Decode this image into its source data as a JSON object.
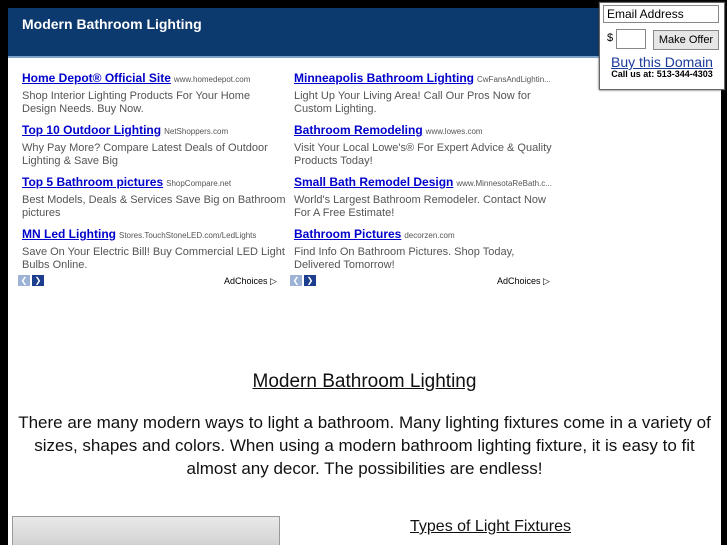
{
  "header": {
    "title": "Modern Bathroom Lighting"
  },
  "ads_left": [
    {
      "title": "Home Depot® Official Site",
      "url": "www.homedepot.com",
      "desc": "Shop Interior Lighting Products For Your Home Design Needs. Buy Now."
    },
    {
      "title": "Top 10 Outdoor Lighting",
      "url": "NetShoppers.com",
      "desc": "Why Pay More? Compare Latest Deals of Outdoor Lighting & Save Big"
    },
    {
      "title": "Top 5 Bathroom pictures",
      "url": "ShopCompare.net",
      "desc": "Best Models, Deals & Services Save Big on Bathroom pictures"
    },
    {
      "title": "MN Led Lighting",
      "url": "Stores.TouchStoneLED.com/LedLights",
      "desc": "Save On Your Electric Bill! Buy Commercial LED Light Bulbs Online."
    }
  ],
  "ads_right": [
    {
      "title": "Minneapolis Bathroom Lighting",
      "url": "CwFansAndLightin...",
      "desc": "Light Up Your Living Area! Call Our Pros Now for Custom Lighting."
    },
    {
      "title": "Bathroom Remodeling",
      "url": "www.lowes.com",
      "desc": "Visit Your Local Lowe's® For Expert Advice & Quality Products Today!"
    },
    {
      "title": "Small Bath Remodel Design",
      "url": "www.MinnesotaReBath.c...",
      "desc": "World's Largest Bathroom Remodeler. Contact Now For A Free Estimate!"
    },
    {
      "title": "Bathroom Pictures",
      "url": "decorzen.com",
      "desc": "Find Info On Bathroom Pictures. Shop Today, Delivered Tomorrow!"
    }
  ],
  "nav": {
    "prev": "❮",
    "next": "❯"
  },
  "adchoices": "AdChoices ▷",
  "main": {
    "heading": "Modern Bathroom Lighting",
    "paragraph": "There are many modern ways to light a bathroom.  Many lighting fixtures come in a variety of sizes, shapes and colors.  When using a modern bathroom lighting fixture, it is easy to fit almost any decor.  The possibilities are endless!",
    "subheading": "Types of Light Fixtures"
  },
  "offer": {
    "email_placeholder": "Email Address",
    "currency": "$",
    "button": "Make Offer",
    "buy_link": "Buy this Domain",
    "call": "Call us at: 513-344-4303"
  },
  "colors": {
    "header_bg": "#0d3a6e",
    "link": "#0000cc",
    "nav_next": "#1d3d8f",
    "nav_prev": "#9db3d6"
  }
}
